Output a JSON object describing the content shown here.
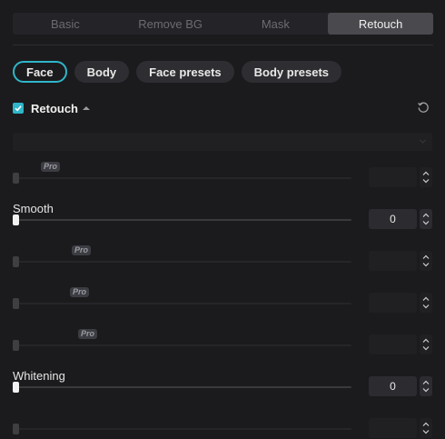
{
  "tabs": [
    {
      "label": "Basic"
    },
    {
      "label": "Remove BG"
    },
    {
      "label": "Mask"
    },
    {
      "label": "Retouch"
    }
  ],
  "pills": [
    {
      "label": "Face"
    },
    {
      "label": "Body"
    },
    {
      "label": "Face presets"
    },
    {
      "label": "Body presets"
    }
  ],
  "section": {
    "title": "Retouch"
  },
  "dropdown": {
    "value": ""
  },
  "pro_badge": "Pro",
  "sliders": [
    {
      "label": "",
      "value": "",
      "pro": true,
      "disabled": true
    },
    {
      "label": "Smooth",
      "value": "0",
      "pro": false,
      "disabled": false
    },
    {
      "label": "",
      "value": "",
      "pro": true,
      "disabled": true
    },
    {
      "label": "",
      "value": "",
      "pro": true,
      "disabled": true
    },
    {
      "label": "",
      "value": "",
      "pro": true,
      "disabled": true
    },
    {
      "label": "Whitening",
      "value": "0",
      "pro": false,
      "disabled": false
    },
    {
      "label": "",
      "value": "",
      "pro": false,
      "disabled": true
    }
  ],
  "colors": {
    "accent": "#2fb6c9",
    "background": "#1b1b1d"
  }
}
